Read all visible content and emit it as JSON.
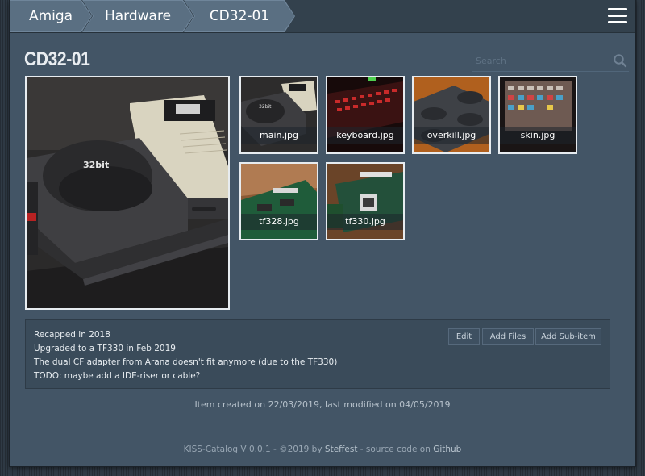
{
  "breadcrumb": [
    "Amiga",
    "Hardware",
    "CD32-01"
  ],
  "page": {
    "title": "CD32-01"
  },
  "search": {
    "placeholder": "Search"
  },
  "main_photo": {
    "alt": "CD32 console with floppy drive"
  },
  "thumbnails": [
    "main.jpg",
    "keyboard.jpg",
    "overkill.jpg",
    "skin.jpg",
    "tf328.jpg",
    "tf330.jpg"
  ],
  "notes": {
    "lines": [
      "Recapped in 2018",
      "Upgraded to a TF330 in Feb 2019",
      "The dual CF adapter from Arana doesn't fit anymore (due to the TF330)",
      "TODO: maybe add a IDE-riser or cable?"
    ],
    "buttons": {
      "edit": "Edit",
      "add_files": "Add Files",
      "add_sub_item": "Add Sub-item"
    }
  },
  "meta": {
    "created_text": "Item created on 22/03/2019, last modified on 04/05/2019"
  },
  "footer": {
    "prefix": "KISS-Catalog V 0.0.1 - ©2019 by ",
    "author": "Steffest",
    "middle": " - source code on ",
    "link": "Github"
  },
  "colors": {
    "panel": "#435566",
    "topbar": "#33414d",
    "crumb": "#5a6f82",
    "background": "#2f3a45"
  },
  "icons": {
    "menu": "hamburger-menu-icon",
    "search": "search-icon"
  }
}
